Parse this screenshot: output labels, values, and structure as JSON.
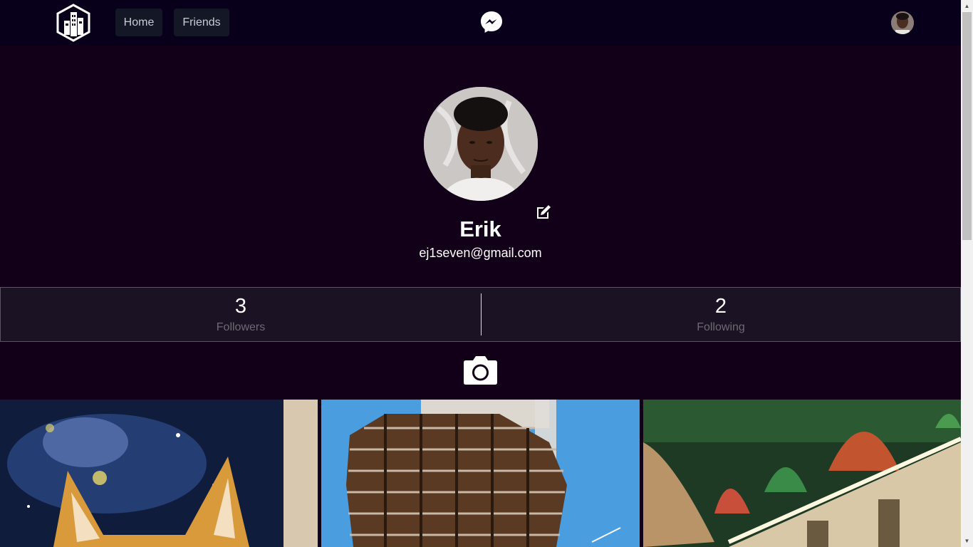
{
  "nav": {
    "logo_icon": "building-logo-icon",
    "home_label": "Home",
    "friends_label": "Friends",
    "messenger_icon": "messenger-icon",
    "avatar_icon": "user-avatar"
  },
  "profile": {
    "name": "Erik",
    "email": "ej1seven@gmail.com",
    "edit_icon": "edit-icon"
  },
  "stats": {
    "followers_count": "3",
    "followers_label": "Followers",
    "following_count": "2",
    "following_label": "Following"
  },
  "upload": {
    "camera_icon": "camera-icon"
  },
  "photos": [
    {
      "subject": "dog-with-galaxy-tapestry"
    },
    {
      "subject": "vessel-building"
    },
    {
      "subject": "grand-central-ceiling"
    }
  ],
  "colors": {
    "background": "#110018",
    "nav_background": "#08001a",
    "stats_background": "#1b1224",
    "nav_button": "#131726"
  }
}
